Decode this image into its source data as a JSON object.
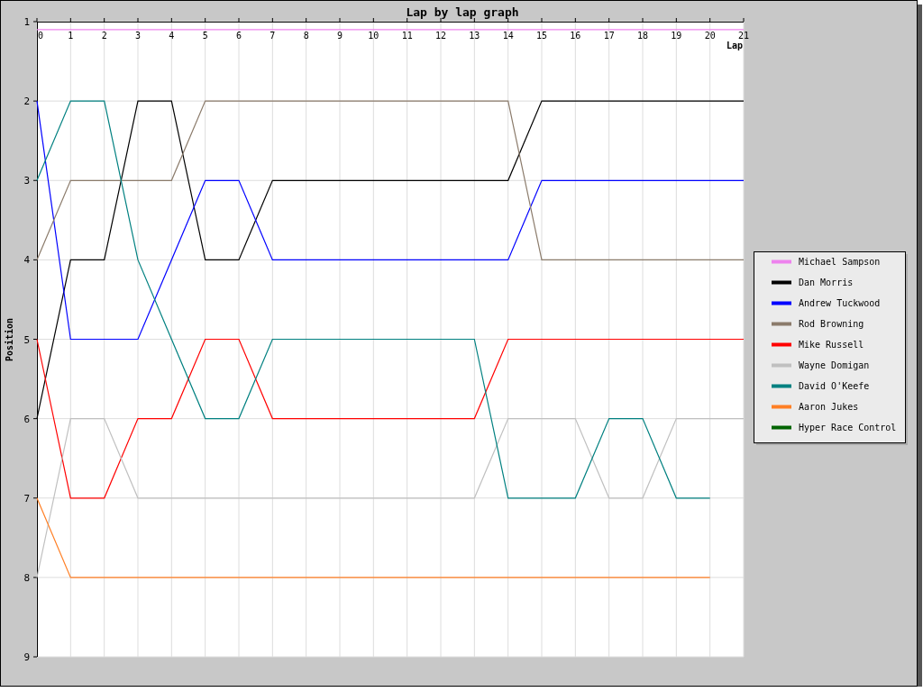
{
  "chart_data": {
    "type": "line",
    "title": "Lap by lap graph",
    "xlabel": "Lap",
    "ylabel": "Position",
    "x": [
      0,
      1,
      2,
      3,
      4,
      5,
      6,
      7,
      8,
      9,
      10,
      11,
      12,
      13,
      14,
      15,
      16,
      17,
      18,
      19,
      20,
      21
    ],
    "xlim": [
      0,
      21
    ],
    "ylim": [
      9,
      1
    ],
    "xticks": [
      0,
      1,
      2,
      3,
      4,
      5,
      6,
      7,
      8,
      9,
      10,
      11,
      12,
      13,
      14,
      15,
      16,
      17,
      18,
      19,
      20,
      21
    ],
    "yticks": [
      1,
      2,
      3,
      4,
      5,
      6,
      7,
      8,
      9
    ],
    "grid": true,
    "legend": true,
    "series": [
      {
        "name": "Michael Sampson",
        "color": "#ee82ee",
        "values": [
          1.1,
          1.1,
          1.1,
          1.1,
          1.1,
          1.1,
          1.1,
          1.1,
          1.1,
          1.1,
          1.1,
          1.1,
          1.1,
          1.1,
          1.1,
          1.1,
          1.1,
          1.1,
          1.1,
          1.1,
          1.1,
          1.1
        ]
      },
      {
        "name": "Dan Morris",
        "color": "#000000",
        "values": [
          6,
          4,
          4,
          2,
          2,
          4,
          4,
          3,
          3,
          3,
          3,
          3,
          3,
          3,
          3,
          2,
          2,
          2,
          2,
          2,
          2,
          2
        ]
      },
      {
        "name": "Andrew Tuckwood",
        "color": "#0000ff",
        "values": [
          2,
          5,
          5,
          5,
          4,
          3,
          3,
          4,
          4,
          4,
          4,
          4,
          4,
          4,
          4,
          3,
          3,
          3,
          3,
          3,
          3,
          3
        ]
      },
      {
        "name": "Rod Browning",
        "color": "#8b7b6b",
        "values": [
          4,
          3,
          3,
          3,
          3,
          2,
          2,
          2,
          2,
          2,
          2,
          2,
          2,
          2,
          2,
          4,
          4,
          4,
          4,
          4,
          4,
          4
        ]
      },
      {
        "name": "Mike Russell",
        "color": "#ff0000",
        "values": [
          5,
          7,
          7,
          6,
          6,
          5,
          5,
          6,
          6,
          6,
          6,
          6,
          6,
          6,
          5,
          5,
          5,
          5,
          5,
          5,
          5,
          5
        ]
      },
      {
        "name": "Wayne Domigan",
        "color": "#c0c0c0",
        "values": [
          8,
          6,
          6,
          7,
          7,
          7,
          7,
          7,
          7,
          7,
          7,
          7,
          7,
          7,
          6,
          6,
          6,
          7,
          7,
          6,
          6,
          6
        ]
      },
      {
        "name": "David O'Keefe",
        "color": "#008080",
        "values": [
          3,
          2,
          2,
          4,
          5,
          6,
          6,
          5,
          5,
          5,
          5,
          5,
          5,
          5,
          7,
          7,
          7,
          6,
          6,
          7,
          7,
          null
        ]
      },
      {
        "name": "Aaron Jukes",
        "color": "#ff7f24",
        "values": [
          7,
          8,
          8,
          8,
          8,
          8,
          8,
          8,
          8,
          8,
          8,
          8,
          8,
          8,
          8,
          8,
          8,
          8,
          8,
          8,
          8,
          null
        ]
      },
      {
        "name": "Hyper Race Control",
        "color": "#006400",
        "values": [
          null,
          null,
          null,
          null,
          null,
          null,
          null,
          null,
          null,
          null,
          null,
          null,
          null,
          null,
          null,
          null,
          null,
          null,
          null,
          null,
          null,
          null
        ]
      }
    ]
  }
}
